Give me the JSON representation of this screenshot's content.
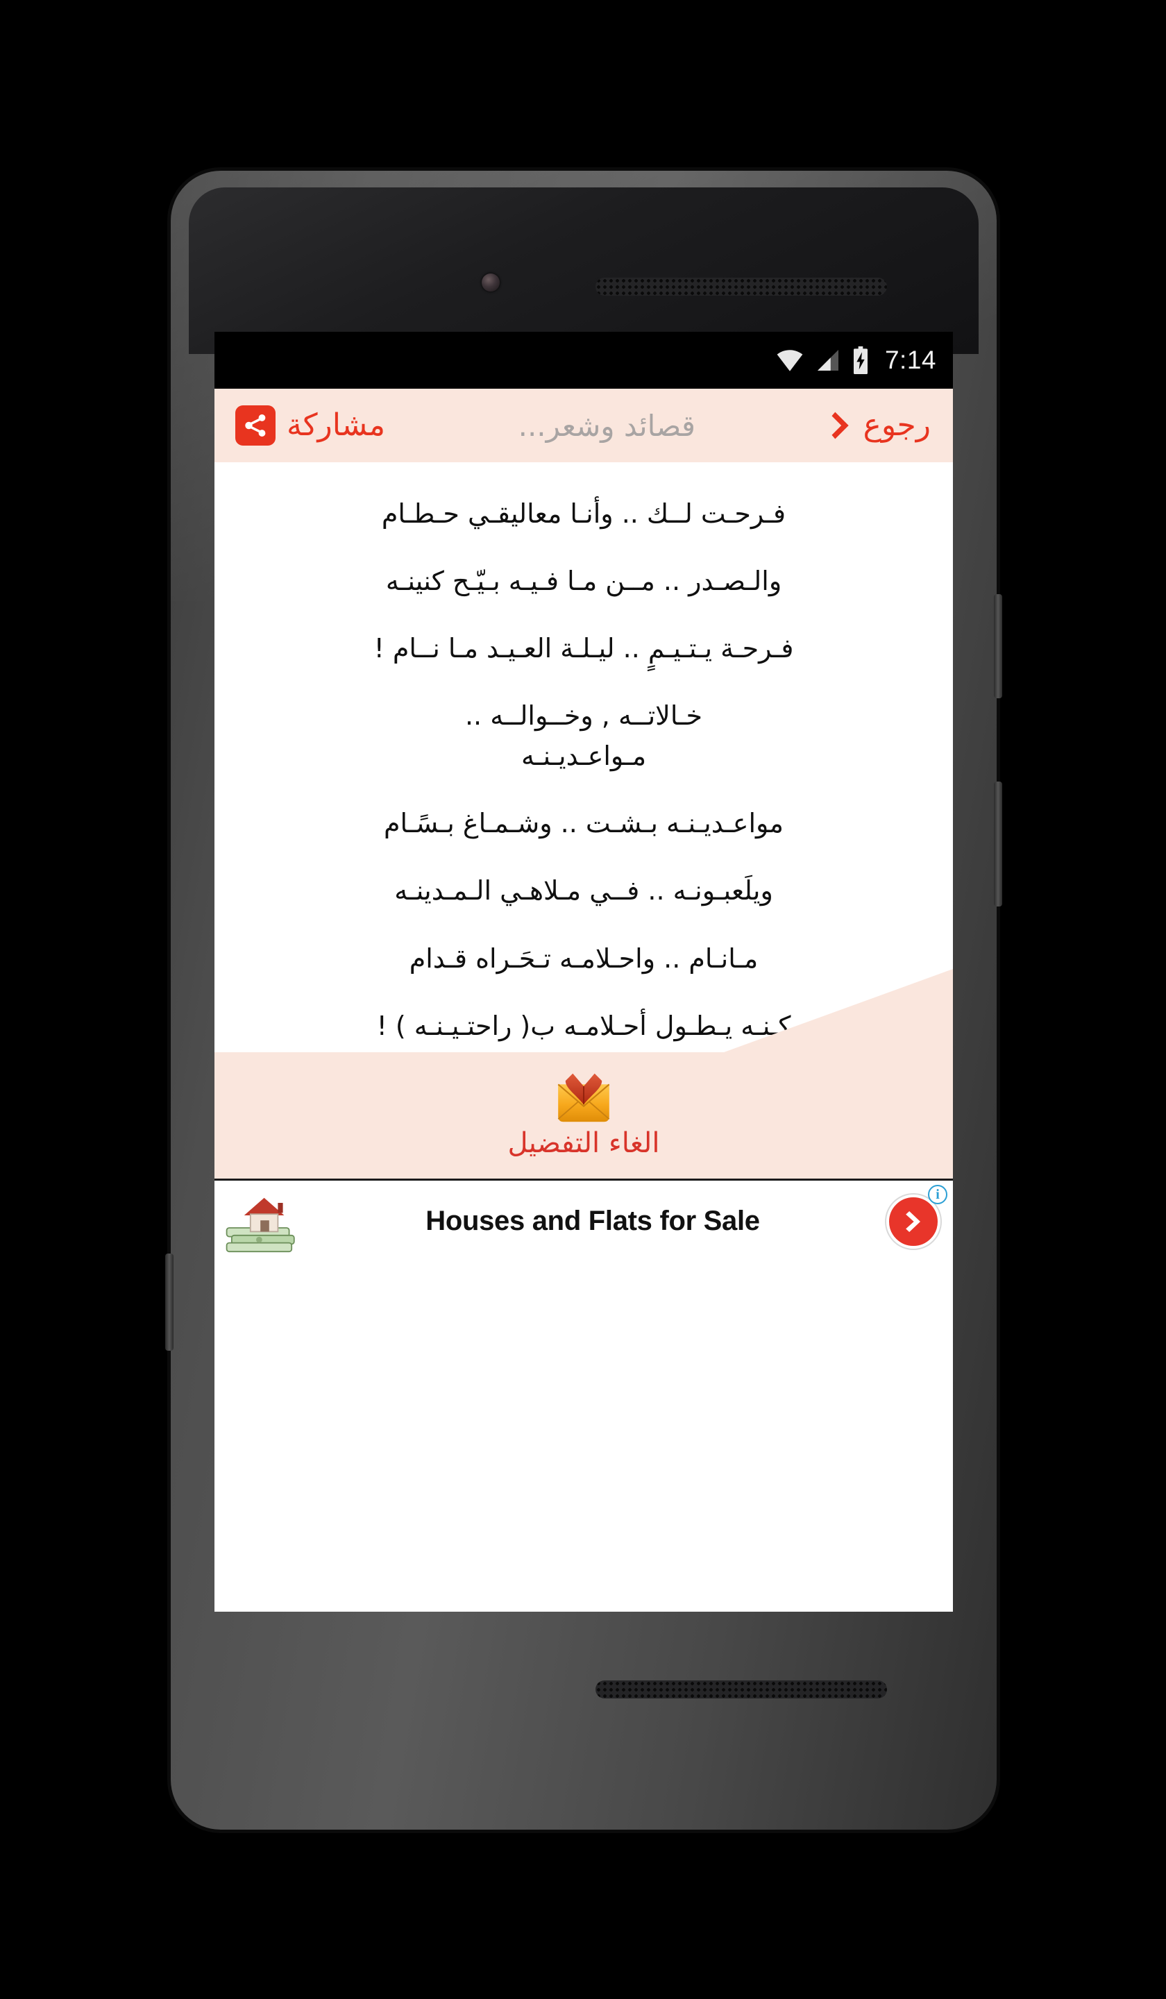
{
  "status_bar": {
    "time": "7:14",
    "icons": [
      "wifi-icon",
      "cellular-signal-icon",
      "battery-charging-icon"
    ]
  },
  "app_bar": {
    "back_label": "رجوع",
    "back_icon": "chevron-right-icon",
    "title": "قصائد وشعر...",
    "share_label": "مشاركة",
    "share_icon": "share-icon"
  },
  "poem": {
    "lines": [
      "فـرحـت لــك .. وأنـا معاليقـي حـطـام",
      "والـصـدر .. مــن مـا فـيـه بـيّـح كنينـه",
      "فـرحـة يـتـيـمٍ .. ليـلـة العـيـد مـا نــام !",
      "خـالاتــه , وخــوالــه ..",
      "مـواعـديـنـه",
      "مواعـديـنـه بـشـت .. وشـمـاغ بـسًـام",
      "ويلَعبـونـه .. فــي مـلاهـي الـمـدينـه",
      "مـانـام .. واحـلامـه تـحَـراه قـدام",
      "كـنـه يـطـول أحـلامـه ب( راحتـيـنـه ) !"
    ]
  },
  "favorite": {
    "label": "الغاء التفضيل",
    "icon": "envelope-heart-icon"
  },
  "ad": {
    "headline": "Houses and Flats for Sale",
    "thumb_icon": "house-money-icon",
    "cta_icon": "chevron-right-circle-icon",
    "info_badge": "i"
  },
  "colors": {
    "accent_red": "#e8341f",
    "favorite_red": "#d8342a",
    "header_peach": "#fae6dd",
    "title_gray": "#a8a4a3",
    "status_bg": "#000000",
    "page_white": "#ffffff"
  }
}
